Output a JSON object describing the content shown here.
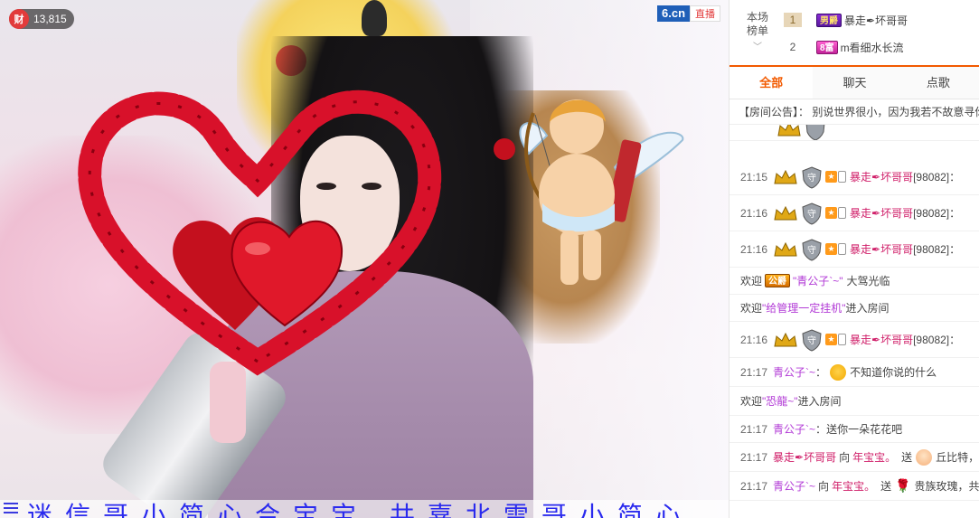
{
  "video": {
    "wealth_icon": "财",
    "wealth_value": "13,815",
    "logo_brand": "6.cn",
    "logo_tag": "直播",
    "ticker_text": "迷信哥小简心合宝宝 共嘉北雷哥小简心"
  },
  "ranking": {
    "label_line1": "本场",
    "label_line2": "榜单",
    "rows": [
      {
        "num": "1",
        "badge": "男爵",
        "name": "暴走✒坏哥哥"
      },
      {
        "num": "2",
        "badge": "8富",
        "name": "m看细水长流"
      }
    ]
  },
  "tabs": [
    "全部",
    "聊天",
    "点歌"
  ],
  "notice": {
    "prefix": "【房间公告】：",
    "text": "别说世界很小，因为我若不故意寻你"
  },
  "chat": {
    "messages": [
      {
        "time": "21:15",
        "name": "暴走✒坏哥哥",
        "id": "[98082]",
        "tail": "："
      },
      {
        "time": "21:16",
        "name": "暴走✒坏哥哥",
        "id": "[98082]",
        "tail": "："
      },
      {
        "time": "21:16",
        "name": "暴走✒坏哥哥",
        "id": "[98082]",
        "tail": "："
      }
    ],
    "welcome1": {
      "prefix": "欢迎",
      "badge": "公爵",
      "name": "\"青公子`~\"",
      "suffix": "大驾光临"
    },
    "welcome2": {
      "prefix": "欢迎",
      "name": "\"给管理一定挂机\"",
      "suffix": "进入房间"
    },
    "msg4": {
      "time": "21:16",
      "name": "暴走✒坏哥哥",
      "id": "[98082]",
      "tail": "："
    },
    "msg5": {
      "time": "21:17",
      "name": "青公子`~",
      "sep": "：",
      "text": "不知道你说的什么"
    },
    "welcome3": {
      "prefix": "欢迎",
      "name": "\"恐龍~\"",
      "suffix": "进入房间"
    },
    "msg6": {
      "time": "21:17",
      "name": "青公子`~",
      "sep": "：",
      "text": "送你一朵花花吧"
    },
    "msg7": {
      "time": "21:17",
      "name": "暴走✒坏哥哥",
      "mid": "向",
      "target": "年宝宝。",
      "verb": "送",
      "gift": "丘比特，"
    },
    "msg8": {
      "time": "21:17",
      "name": "青公子`~",
      "mid": "向",
      "target": "年宝宝。",
      "verb": "送",
      "gift": "贵族玫瑰，共"
    }
  }
}
